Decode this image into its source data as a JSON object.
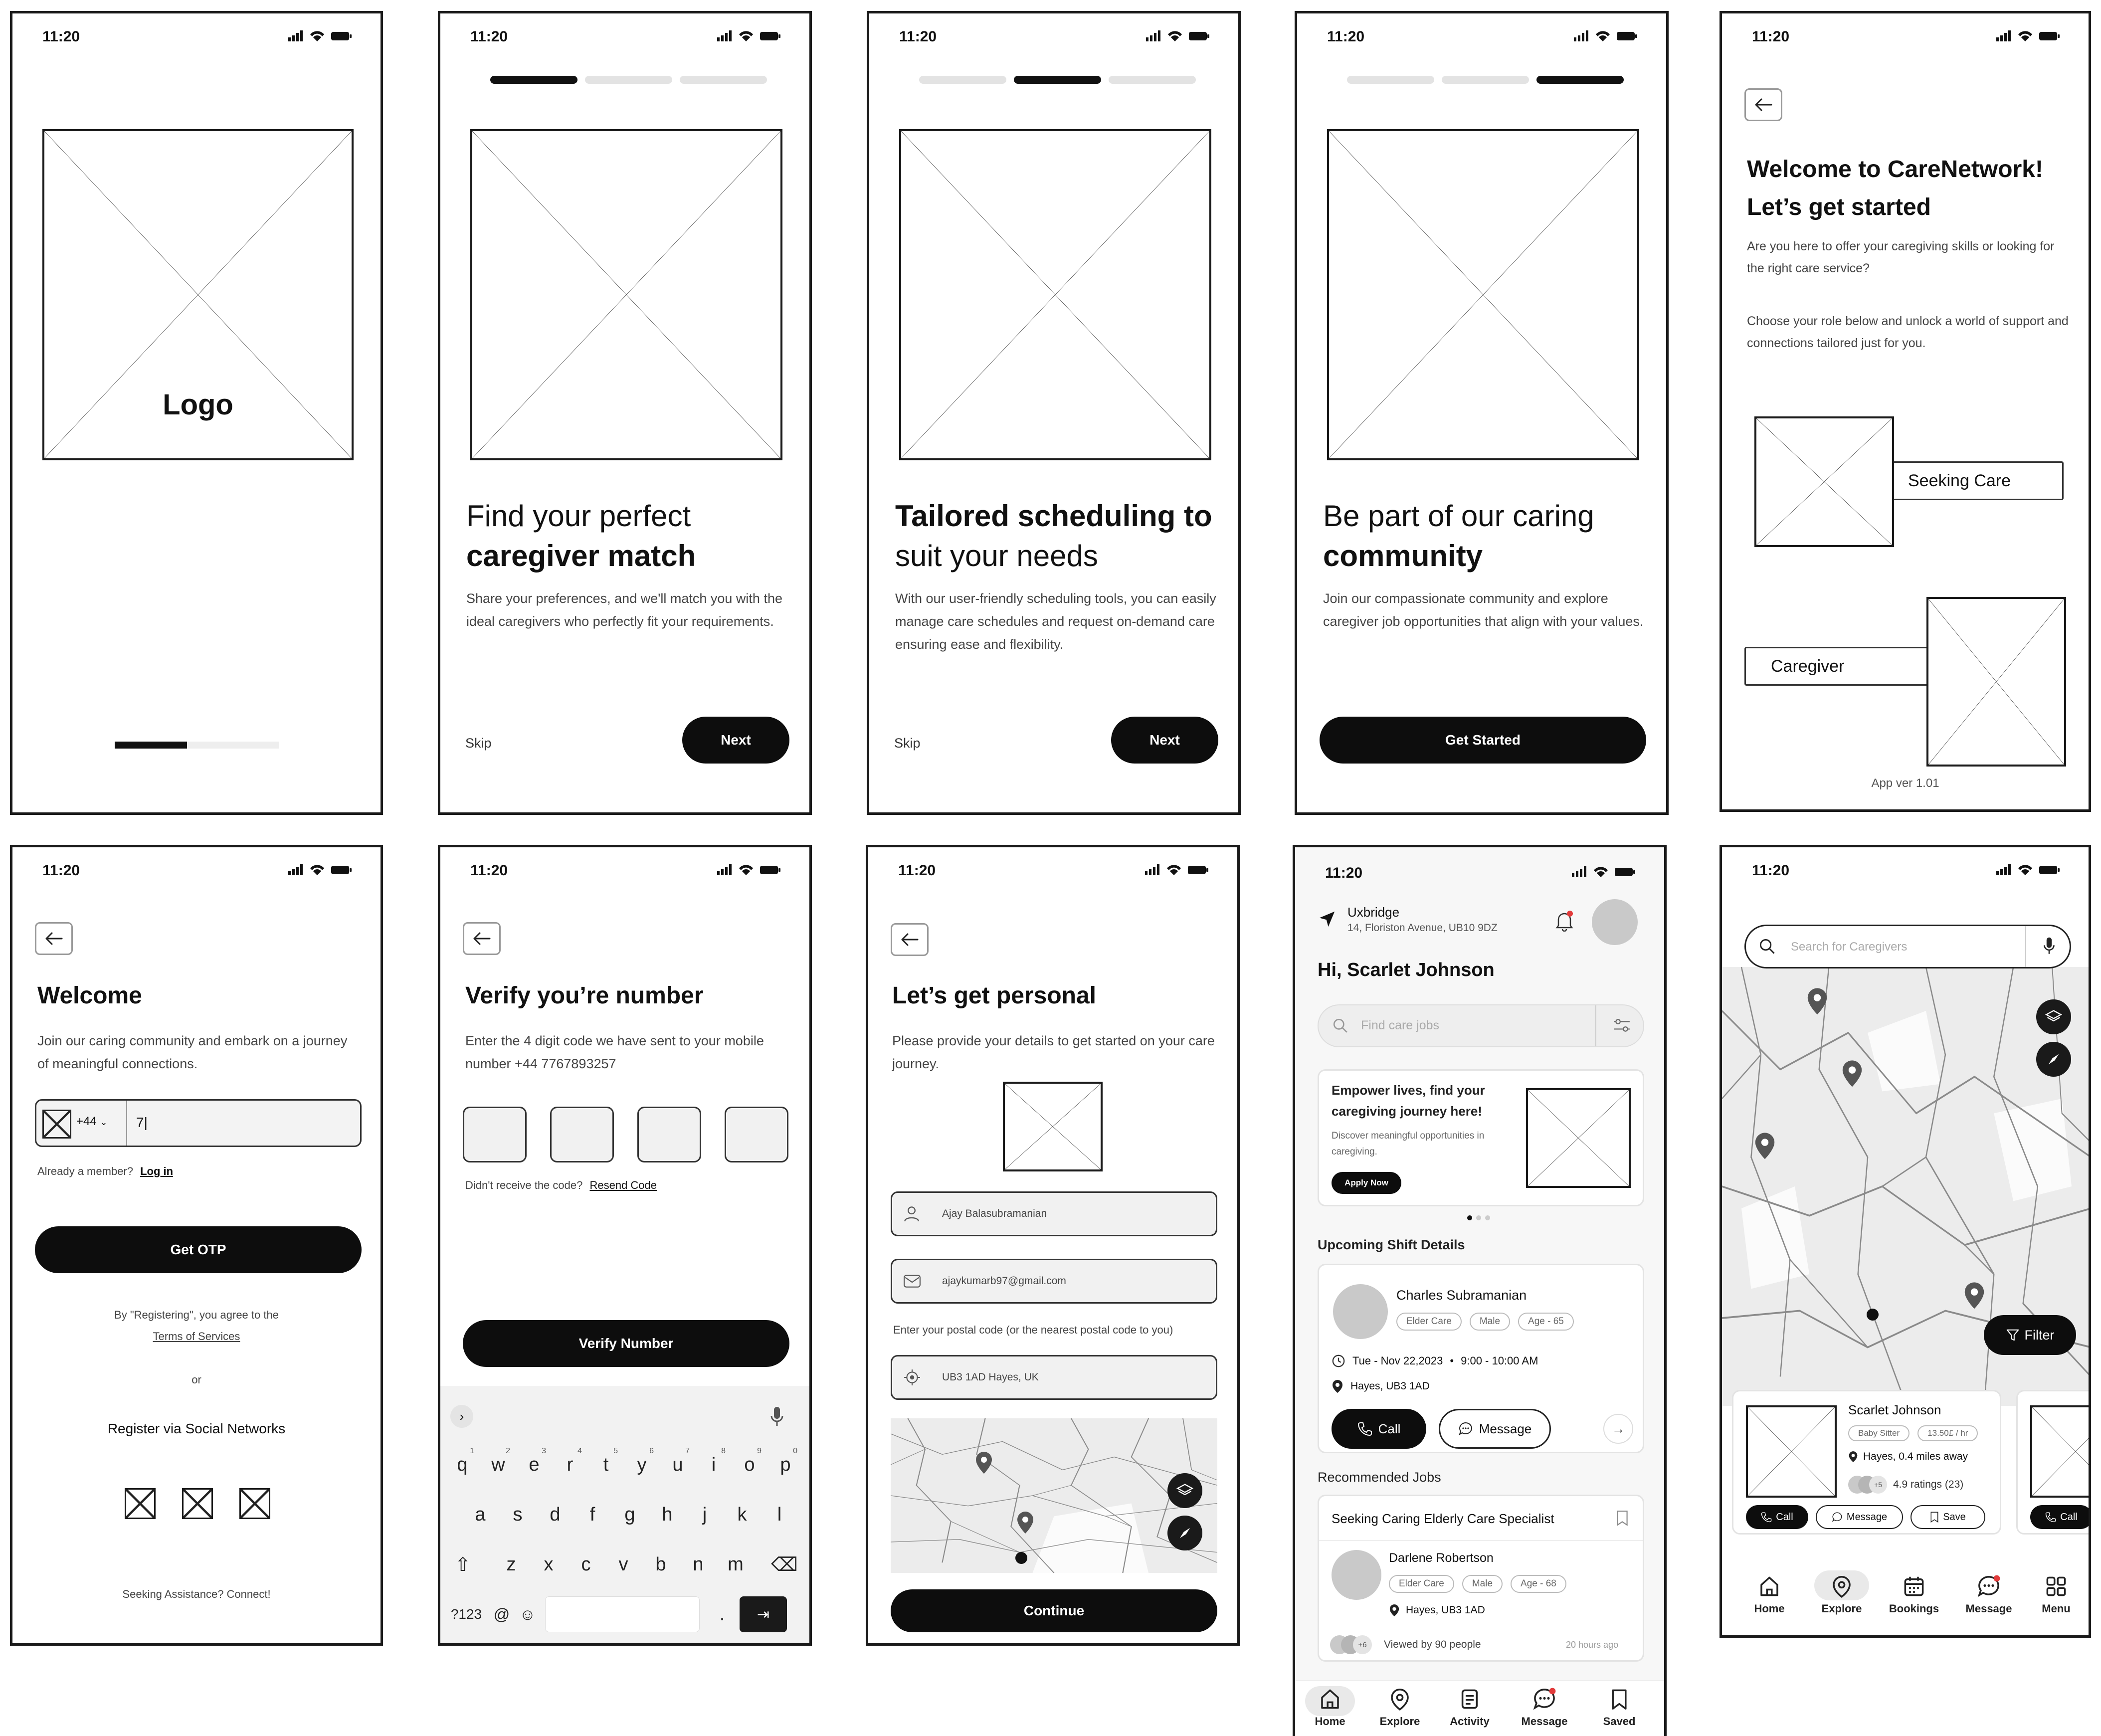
{
  "status_time": "11:20",
  "screen1": {
    "logo_label": "Logo",
    "loader_progress": 0.44
  },
  "screen2": {
    "step_progress": [
      1,
      0,
      0
    ],
    "title_line1": "Find your perfect",
    "title_line2": "caregiver match",
    "body": "Share your preferences, and we'll match you with the ideal caregivers who perfectly fit your requirements.",
    "skip": "Skip",
    "next": "Next"
  },
  "screen3": {
    "step_progress": [
      0,
      1,
      0
    ],
    "title_line1": "Tailored scheduling to",
    "title_line2": "suit your needs",
    "body": "With our user-friendly scheduling tools, you can easily manage care schedules and request on-demand care ensuring ease and flexibility.",
    "skip": "Skip",
    "next": "Next"
  },
  "screen4": {
    "step_progress": [
      0,
      0,
      1
    ],
    "title_line1": "Be part of our caring",
    "title_line2": "community",
    "body": "Join our compassionate community and explore caregiver job opportunities that align with your values.",
    "cta": "Get Started"
  },
  "screen5": {
    "title_line1": "Welcome to CareNetwork!",
    "title_line2": "Let’s get started",
    "body1": "Are you here to offer your caregiving skills or looking for the right care service?",
    "body2": "Choose your role below and unlock a world of support and connections tailored just for you.",
    "role1": "Seeking Care",
    "role2": "Caregiver",
    "version": "App ver 1.01"
  },
  "screen6": {
    "title": "Welcome",
    "body": "Join our caring community and embark on a journey of meaningful connections.",
    "country_code": "+44",
    "phone_value": "7|",
    "already": "Already a member?",
    "login": "Log in",
    "cta": "Get OTP",
    "agree": "By \"Registering\", you agree to the",
    "terms": "Terms of Services",
    "or": "or",
    "social_heading": "Register via Social Networks",
    "footer": "Seeking Assistance? Connect!"
  },
  "screen7": {
    "title": "Verify you’re number",
    "body": "Enter the 4 digit code we have sent  to your mobile number +44 7767893257",
    "not_received": "Didn't receive the code?",
    "resend": "Resend Code",
    "cta": "Verify Number",
    "keyboard": {
      "row1": [
        [
          "q",
          "1"
        ],
        [
          "w",
          "2"
        ],
        [
          "e",
          "3"
        ],
        [
          "r",
          "4"
        ],
        [
          "t",
          "5"
        ],
        [
          "y",
          "6"
        ],
        [
          "u",
          "7"
        ],
        [
          "i",
          "8"
        ],
        [
          "o",
          "9"
        ],
        [
          "p",
          "0"
        ]
      ],
      "row2": [
        "a",
        "s",
        "d",
        "f",
        "g",
        "h",
        "j",
        "k",
        "l"
      ],
      "row3": [
        "z",
        "x",
        "c",
        "v",
        "b",
        "n",
        "m"
      ],
      "num_key": "?123",
      "at_key": "@",
      "dot_key": "."
    }
  },
  "screen8": {
    "title": "Let’s get personal",
    "body": "Please provide your details to get started on your care journey.",
    "name_value": "Ajay Balasubramanian",
    "email_value": "ajaykumarb97@gmail.com",
    "postal_hint": "Enter your postal code (or the nearest postal code to you)",
    "postal_value": "UB3 1AD Hayes, UK",
    "cta": "Continue"
  },
  "screen9": {
    "location_name": "Uxbridge",
    "location_address": "14, Floriston Avenue, UB10 9DZ",
    "greeting": "Hi, Scarlet Johnson",
    "search_placeholder": "Find care jobs",
    "promo_title": "Empower lives, find your caregiving journey here!",
    "promo_body": "Discover meaningful opportunities in caregiving.",
    "promo_cta": "Apply Now",
    "upcoming_heading": "Upcoming Shift Details",
    "shift_name": "Charles Subramanian",
    "shift_chips": [
      "Elder Care",
      "Male",
      "Age - 65"
    ],
    "shift_date": "Tue - Nov 22,2023",
    "shift_time": "9:00 - 10:00 AM",
    "shift_place": "Hayes, UB3 1AD",
    "call": "Call",
    "message": "Message",
    "recommended_heading": "Recommended Jobs",
    "job_title": "Seeking Caring Elderly Care Specialist",
    "job_name": "Darlene Robertson",
    "job_chips": [
      "Elder Care",
      "Male",
      "Age - 68"
    ],
    "job_place": "Hayes, UB3 1AD",
    "viewed_count": "+6",
    "viewed": "Viewed by 90 people",
    "posted": "20 hours ago",
    "nav": [
      "Home",
      "Explore",
      "Activity",
      "Message",
      "Saved"
    ]
  },
  "screen10": {
    "search_placeholder": "Search for Caregivers",
    "filter": "Filter",
    "card_name": "Scarlet Johnson",
    "card_chips": [
      "Baby Sitter",
      "13.50£ / hr"
    ],
    "card_distance": "Hayes, 0.4 miles away",
    "card_count": "+5",
    "card_rating": "4.9 ratings (23)",
    "call": "Call",
    "message": "Message",
    "save": "Save",
    "call2": "Call",
    "nav": [
      "Home",
      "Explore",
      "Bookings",
      "Message",
      "Menu"
    ]
  }
}
